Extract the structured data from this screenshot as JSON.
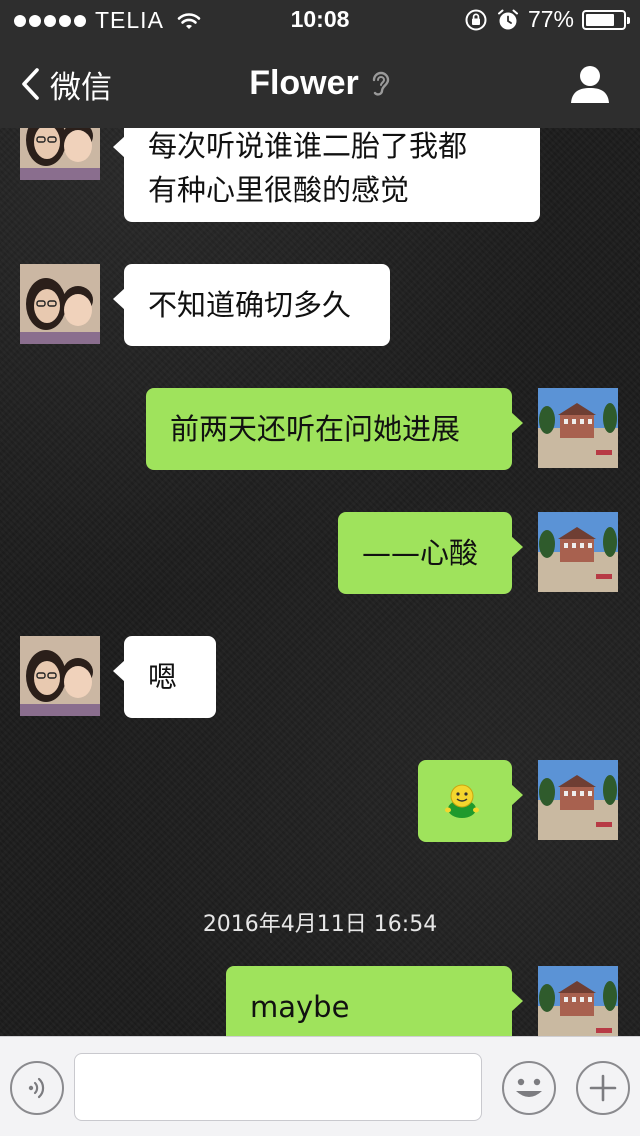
{
  "status_bar": {
    "carrier": "TELIA",
    "time": "10:08",
    "battery": "77%",
    "battery_level": 0.77
  },
  "nav": {
    "back_label": "微信",
    "title": "Flower"
  },
  "messages": [
    {
      "side": "in",
      "lines": [
        "每次听说谁谁二胎了我都",
        "有种心里很酸的感觉"
      ]
    },
    {
      "side": "in",
      "lines": [
        "不知道确切多久"
      ]
    },
    {
      "side": "out",
      "lines": [
        "前两天还听在问她进展"
      ]
    },
    {
      "side": "out",
      "lines": [
        "——心酸"
      ]
    },
    {
      "side": "in",
      "lines": [
        "嗯"
      ]
    },
    {
      "side": "out",
      "emoji": "green-smiley-emoji"
    },
    {
      "side": "out",
      "lines": [
        "maybe someday"
      ]
    }
  ],
  "timestamp": "2016年4月11日 16:54",
  "input": {
    "value": ""
  },
  "colors": {
    "bar_bg": "#2e2e2e",
    "bubble_out": "#9fe35c",
    "bubble_in": "#ffffff",
    "input_bar_bg": "#f3f3f5"
  },
  "icons": [
    "wifi-icon",
    "rotation-lock-icon",
    "alarm-icon",
    "battery-icon",
    "back-chevron-icon",
    "ear-icon",
    "profile-icon",
    "voice-icon",
    "emoji-icon",
    "plus-icon"
  ]
}
